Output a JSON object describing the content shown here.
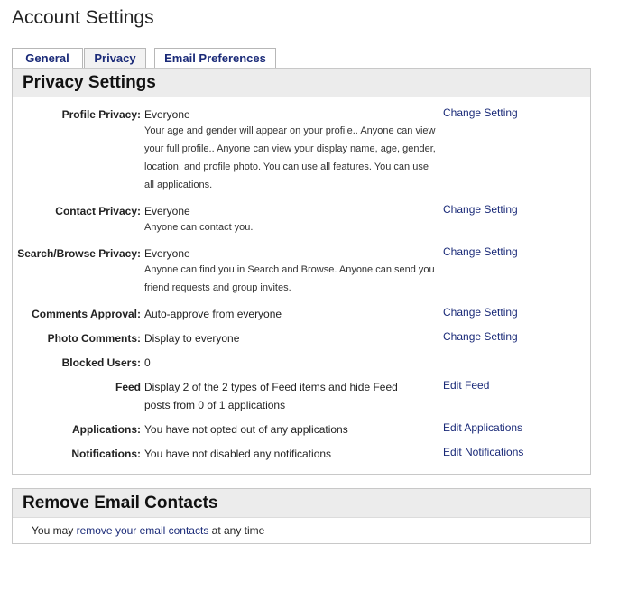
{
  "page": {
    "title": "Account Settings"
  },
  "tabs": [
    {
      "label": "General"
    },
    {
      "label": "Privacy"
    },
    {
      "label": "Email Preferences"
    }
  ],
  "privacy": {
    "header": "Privacy Settings",
    "rows": [
      {
        "label": "Profile Privacy:",
        "value": "Everyone",
        "desc": "Your age and gender will appear on your profile.. Anyone can view your full profile.. Anyone can view your display name, age, gender, location, and profile photo. You can use all features. You can use all applications.",
        "action": "Change Setting"
      },
      {
        "label": "Contact Privacy:",
        "value": "Everyone",
        "desc": "Anyone can contact you.",
        "action": "Change Setting"
      },
      {
        "label": "Search/Browse Privacy:",
        "value": "Everyone",
        "desc": "Anyone can find you in Search and Browse. Anyone can send you friend requests and group invites.",
        "action": "Change Setting"
      },
      {
        "label": "Comments Approval:",
        "value": "Auto-approve from everyone",
        "action": "Change Setting"
      },
      {
        "label": "Photo Comments:",
        "value": "Display to everyone",
        "action": "Change Setting"
      },
      {
        "label": "Blocked Users:",
        "value": "0"
      },
      {
        "label": "Feed",
        "value": "Display 2 of the 2 types of Feed items and hide Feed posts from 0 of 1 applications",
        "action": "Edit Feed"
      },
      {
        "label": "Applications:",
        "value": "You have not opted out of any applications",
        "action": "Edit Applications"
      },
      {
        "label": "Notifications:",
        "value": "You have not disabled any notifications",
        "action": "Edit Notifications"
      }
    ]
  },
  "email_contacts": {
    "header": "Remove Email Contacts",
    "text_before": "You may ",
    "link": "remove your email contacts",
    "text_after": " at any time"
  }
}
